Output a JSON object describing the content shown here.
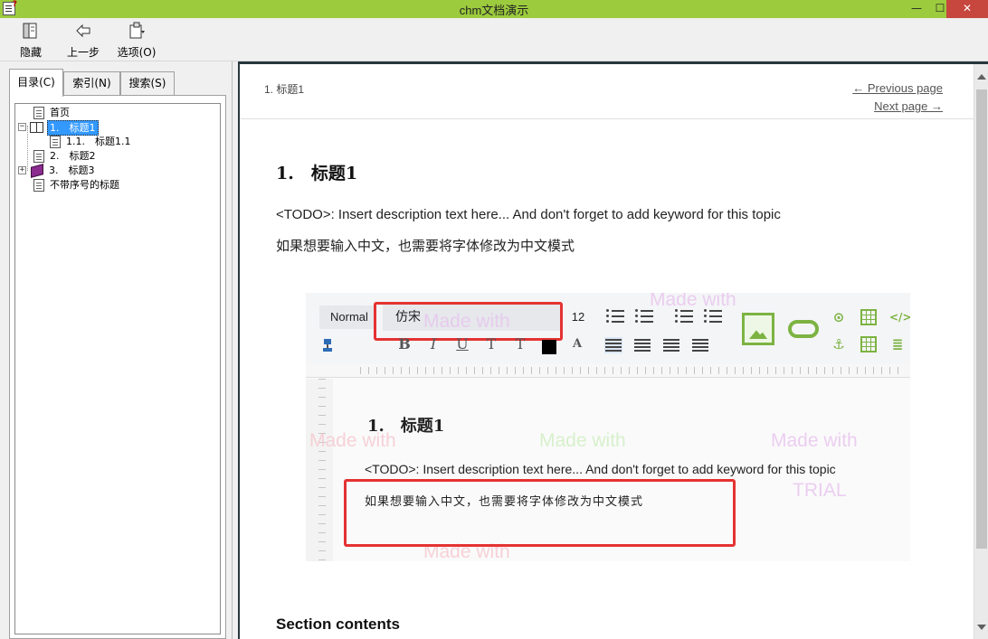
{
  "window": {
    "title": "chm文档演示",
    "min_glyph": "—",
    "max_glyph": "☐",
    "close_glyph": "✕"
  },
  "toolbar": {
    "hide_label": "隐藏",
    "back_label": "上一步",
    "options_label": "选项(O)"
  },
  "tabs": {
    "contents": "目录(C)",
    "index": "索引(N)",
    "search": "搜索(S)"
  },
  "tree": {
    "items": [
      {
        "label": "首页"
      },
      {
        "label": "1.　标题1"
      },
      {
        "label": "1.1.　标题1.1"
      },
      {
        "label": "2.　标题2"
      },
      {
        "label": "3.　标题3"
      },
      {
        "label": "不带序号的标题"
      }
    ],
    "expanders": {
      "open": "−",
      "closed": "+"
    }
  },
  "content": {
    "breadcrumb": "1. 标题1",
    "prev_link": "← Previous page",
    "next_link": "Next page →",
    "heading": "1.　标题1",
    "paragraph1": "<TODO>: Insert description text here... And don't forget to add keyword for this topic",
    "paragraph2": "如果想要输入中文，也需要将字体修改为中文模式",
    "section_heading": "Section contents"
  },
  "screenshot": {
    "style_value": "Normal",
    "font_value": "仿宋",
    "size_value": "12",
    "bold": "B",
    "italic": "I",
    "underline": "U",
    "text_a": "A",
    "heading": "1.　标题1",
    "paragraph1": "<TODO>: Insert description text here... And don't forget to add keyword for this topic",
    "paragraph2": "如果想要输入中文，也需要将字体修改为中文模式",
    "anchor_glyph": "⚓",
    "watermark_made": "Made with",
    "watermark_trial": "TRIAL"
  },
  "colors": {
    "titlebar": "#9ccb3d",
    "close_button": "#c7463e",
    "highlight_box": "#e53232",
    "selection": "#3399ff"
  }
}
